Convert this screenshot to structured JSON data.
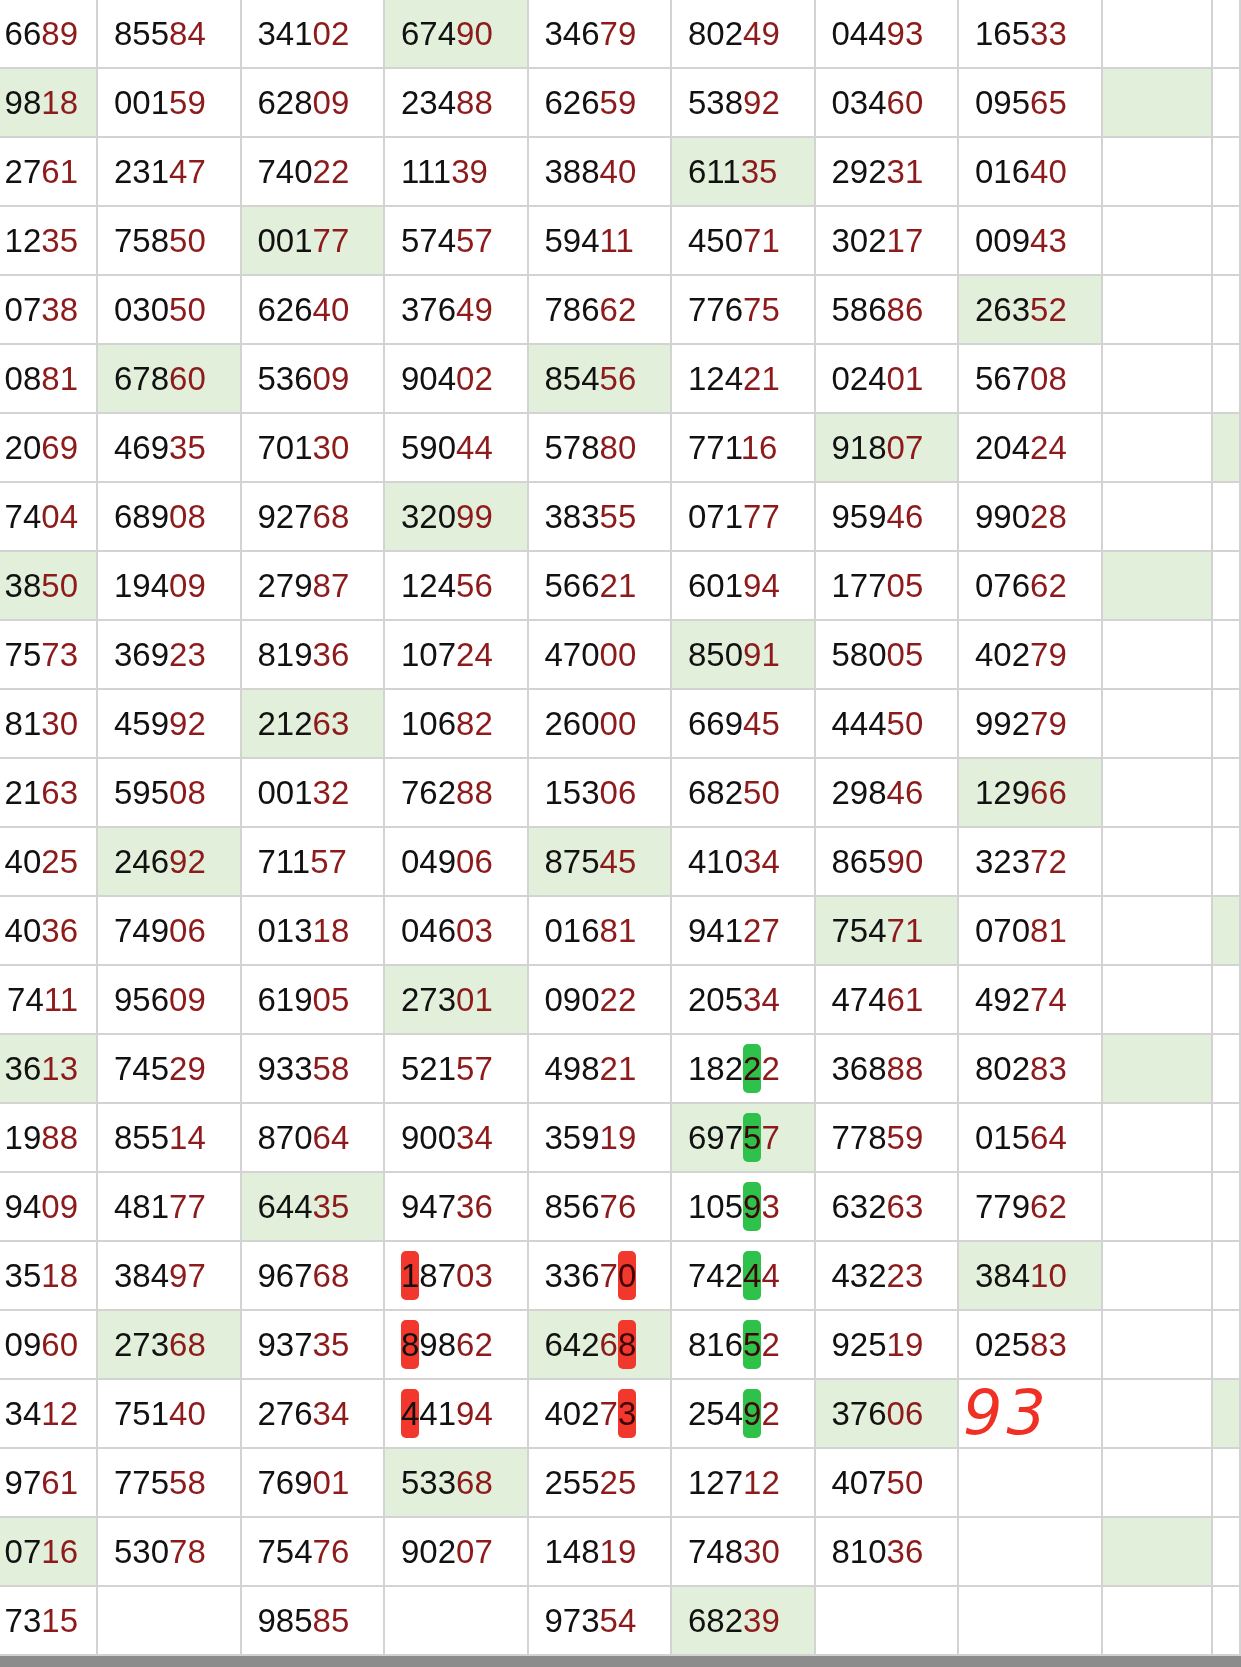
{
  "rows": [
    {
      "cells": [
        {
          "text": "6689",
          "highlighted": false
        },
        {
          "text": "85584",
          "highlighted": false
        },
        {
          "text": "34102",
          "highlighted": false
        },
        {
          "text": "67490",
          "highlighted": true
        },
        {
          "text": "34679",
          "highlighted": false
        },
        {
          "text": "80249",
          "highlighted": false
        },
        {
          "text": "04493",
          "highlighted": false
        },
        {
          "text": "16533",
          "highlighted": false
        },
        {
          "highlighted": false
        },
        {
          "highlighted": false
        }
      ]
    },
    {
      "cells": [
        {
          "text": "9818",
          "highlighted": true
        },
        {
          "text": "00159",
          "highlighted": false
        },
        {
          "text": "62809",
          "highlighted": false
        },
        {
          "text": "23488",
          "highlighted": false
        },
        {
          "text": "62659",
          "highlighted": false
        },
        {
          "text": "53892",
          "highlighted": false
        },
        {
          "text": "03460",
          "highlighted": false
        },
        {
          "text": "09565",
          "highlighted": false
        },
        {
          "highlighted": true
        },
        {
          "highlighted": false
        }
      ]
    },
    {
      "cells": [
        {
          "text": "2761",
          "highlighted": false
        },
        {
          "text": "23147",
          "highlighted": false
        },
        {
          "text": "74022",
          "highlighted": false
        },
        {
          "text": "11139",
          "highlighted": false
        },
        {
          "text": "38840",
          "highlighted": false
        },
        {
          "text": "61135",
          "highlighted": true
        },
        {
          "text": "29231",
          "highlighted": false
        },
        {
          "text": "01640",
          "highlighted": false
        },
        {
          "highlighted": false
        },
        {
          "highlighted": false
        }
      ]
    },
    {
      "cells": [
        {
          "text": "1235",
          "highlighted": false
        },
        {
          "text": "75850",
          "highlighted": false
        },
        {
          "text": "00177",
          "highlighted": true
        },
        {
          "text": "57457",
          "highlighted": false
        },
        {
          "text": "59411",
          "highlighted": false
        },
        {
          "text": "45071",
          "highlighted": false
        },
        {
          "text": "30217",
          "highlighted": false
        },
        {
          "text": "00943",
          "highlighted": false
        },
        {
          "highlighted": false
        },
        {
          "highlighted": false
        }
      ]
    },
    {
      "cells": [
        {
          "text": "0738",
          "highlighted": false
        },
        {
          "text": "03050",
          "highlighted": false
        },
        {
          "text": "62640",
          "highlighted": false
        },
        {
          "text": "37649",
          "highlighted": false
        },
        {
          "text": "78662",
          "highlighted": false
        },
        {
          "text": "77675",
          "highlighted": false
        },
        {
          "text": "58686",
          "highlighted": false
        },
        {
          "text": "26352",
          "highlighted": true
        },
        {
          "highlighted": false
        },
        {
          "highlighted": false
        }
      ]
    },
    {
      "cells": [
        {
          "text": "0881",
          "highlighted": false
        },
        {
          "text": "67860",
          "highlighted": true
        },
        {
          "text": "53609",
          "highlighted": false
        },
        {
          "text": "90402",
          "highlighted": false
        },
        {
          "text": "85456",
          "highlighted": true
        },
        {
          "text": "12421",
          "highlighted": false
        },
        {
          "text": "02401",
          "highlighted": false
        },
        {
          "text": "56708",
          "highlighted": false
        },
        {
          "highlighted": false
        },
        {
          "highlighted": false
        }
      ]
    },
    {
      "cells": [
        {
          "text": "2069",
          "highlighted": false
        },
        {
          "text": "46935",
          "highlighted": false
        },
        {
          "text": "70130",
          "highlighted": false
        },
        {
          "text": "59044",
          "highlighted": false
        },
        {
          "text": "57880",
          "highlighted": false
        },
        {
          "text": "77116",
          "highlighted": false
        },
        {
          "text": "91807",
          "highlighted": true
        },
        {
          "text": "20424",
          "highlighted": false
        },
        {
          "highlighted": false
        },
        {
          "highlighted": true
        }
      ]
    },
    {
      "cells": [
        {
          "text": "7404",
          "highlighted": false
        },
        {
          "text": "68908",
          "highlighted": false
        },
        {
          "text": "92768",
          "highlighted": false
        },
        {
          "text": "32099",
          "highlighted": true
        },
        {
          "text": "38355",
          "highlighted": false
        },
        {
          "text": "07177",
          "highlighted": false
        },
        {
          "text": "95946",
          "highlighted": false
        },
        {
          "text": "99028",
          "highlighted": false
        },
        {
          "highlighted": false
        },
        {
          "highlighted": false
        }
      ]
    },
    {
      "cells": [
        {
          "text": "3850",
          "highlighted": true
        },
        {
          "text": "19409",
          "highlighted": false
        },
        {
          "text": "27987",
          "highlighted": false
        },
        {
          "text": "12456",
          "highlighted": false
        },
        {
          "text": "56621",
          "highlighted": false
        },
        {
          "text": "60194",
          "highlighted": false
        },
        {
          "text": "17705",
          "highlighted": false
        },
        {
          "text": "07662",
          "highlighted": false
        },
        {
          "highlighted": true
        },
        {
          "highlighted": false
        }
      ]
    },
    {
      "cells": [
        {
          "text": "7573",
          "highlighted": false
        },
        {
          "text": "36923",
          "highlighted": false
        },
        {
          "text": "81936",
          "highlighted": false
        },
        {
          "text": "10724",
          "highlighted": false
        },
        {
          "text": "47000",
          "highlighted": false
        },
        {
          "text": "85091",
          "highlighted": true
        },
        {
          "text": "58005",
          "highlighted": false
        },
        {
          "text": "40279",
          "highlighted": false
        },
        {
          "highlighted": false
        },
        {
          "highlighted": false
        }
      ]
    },
    {
      "cells": [
        {
          "text": "8130",
          "highlighted": false
        },
        {
          "text": "45992",
          "highlighted": false
        },
        {
          "text": "21263",
          "highlighted": true
        },
        {
          "text": "10682",
          "highlighted": false
        },
        {
          "text": "26000",
          "highlighted": false
        },
        {
          "text": "66945",
          "highlighted": false
        },
        {
          "text": "44450",
          "highlighted": false
        },
        {
          "text": "99279",
          "highlighted": false
        },
        {
          "highlighted": false
        },
        {
          "highlighted": false
        }
      ]
    },
    {
      "cells": [
        {
          "text": "2163",
          "highlighted": false
        },
        {
          "text": "59508",
          "highlighted": false
        },
        {
          "text": "00132",
          "highlighted": false
        },
        {
          "text": "76288",
          "highlighted": false
        },
        {
          "text": "15306",
          "highlighted": false
        },
        {
          "text": "68250",
          "highlighted": false
        },
        {
          "text": "29846",
          "highlighted": false
        },
        {
          "text": "12966",
          "highlighted": true
        },
        {
          "highlighted": false
        },
        {
          "highlighted": false
        }
      ]
    },
    {
      "cells": [
        {
          "text": "4025",
          "highlighted": false
        },
        {
          "text": "24692",
          "highlighted": true
        },
        {
          "text": "71157",
          "highlighted": false
        },
        {
          "text": "04906",
          "highlighted": false
        },
        {
          "text": "87545",
          "highlighted": true
        },
        {
          "text": "41034",
          "highlighted": false
        },
        {
          "text": "86590",
          "highlighted": false
        },
        {
          "text": "32372",
          "highlighted": false
        },
        {
          "highlighted": false
        },
        {
          "highlighted": false
        }
      ]
    },
    {
      "cells": [
        {
          "text": "4036",
          "highlighted": false
        },
        {
          "text": "74906",
          "highlighted": false
        },
        {
          "text": "01318",
          "highlighted": false
        },
        {
          "text": "04603",
          "highlighted": false
        },
        {
          "text": "01681",
          "highlighted": false
        },
        {
          "text": "94127",
          "highlighted": false
        },
        {
          "text": "75471",
          "highlighted": true
        },
        {
          "text": "07081",
          "highlighted": false
        },
        {
          "highlighted": false
        },
        {
          "highlighted": true
        }
      ]
    },
    {
      "cells": [
        {
          "text": "7411",
          "highlighted": false
        },
        {
          "text": "95609",
          "highlighted": false
        },
        {
          "text": "61905",
          "highlighted": false
        },
        {
          "text": "27301",
          "highlighted": true
        },
        {
          "text": "09022",
          "highlighted": false
        },
        {
          "text": "20534",
          "highlighted": false
        },
        {
          "text": "47461",
          "highlighted": false
        },
        {
          "text": "49274",
          "highlighted": false
        },
        {
          "highlighted": false
        },
        {
          "highlighted": false
        }
      ]
    },
    {
      "cells": [
        {
          "text": "3613",
          "highlighted": true
        },
        {
          "text": "74529",
          "highlighted": false
        },
        {
          "text": "93358",
          "highlighted": false
        },
        {
          "text": "52157",
          "highlighted": false
        },
        {
          "text": "49821",
          "highlighted": false
        },
        {
          "text": "18222",
          "highlighted": false,
          "marker": {
            "color": "#2fc24a",
            "kind": "fourth"
          }
        },
        {
          "text": "36888",
          "highlighted": false
        },
        {
          "text": "80283",
          "highlighted": false
        },
        {
          "highlighted": true
        },
        {
          "highlighted": false
        }
      ]
    },
    {
      "cells": [
        {
          "text": "1988",
          "highlighted": false
        },
        {
          "text": "85514",
          "highlighted": false
        },
        {
          "text": "87064",
          "highlighted": false
        },
        {
          "text": "90034",
          "highlighted": false
        },
        {
          "text": "35919",
          "highlighted": false
        },
        {
          "text": "69757",
          "highlighted": true,
          "marker": {
            "color": "#2fc24a",
            "kind": "fourth"
          }
        },
        {
          "text": "77859",
          "highlighted": false
        },
        {
          "text": "01564",
          "highlighted": false
        },
        {
          "highlighted": false
        },
        {
          "highlighted": false
        }
      ]
    },
    {
      "cells": [
        {
          "text": "9409",
          "highlighted": false
        },
        {
          "text": "48177",
          "highlighted": false
        },
        {
          "text": "64435",
          "highlighted": true
        },
        {
          "text": "94736",
          "highlighted": false
        },
        {
          "text": "85676",
          "highlighted": false
        },
        {
          "text": "10593",
          "highlighted": false,
          "marker": {
            "color": "#2fc24a",
            "kind": "fourth"
          }
        },
        {
          "text": "63263",
          "highlighted": false
        },
        {
          "text": "77962",
          "highlighted": false
        },
        {
          "highlighted": false
        },
        {
          "highlighted": false
        }
      ]
    },
    {
      "cells": [
        {
          "text": "3518",
          "highlighted": false
        },
        {
          "text": "38497",
          "highlighted": false
        },
        {
          "text": "96768",
          "highlighted": false
        },
        {
          "text": "18703",
          "highlighted": false,
          "marker": {
            "color": "#f2382c",
            "kind": "first"
          }
        },
        {
          "text": "33670",
          "highlighted": false,
          "marker": {
            "color": "#f2382c",
            "kind": "last"
          }
        },
        {
          "text": "74244",
          "highlighted": false,
          "marker": {
            "color": "#2fc24a",
            "kind": "fourth"
          }
        },
        {
          "text": "43223",
          "highlighted": false
        },
        {
          "text": "38410",
          "highlighted": true
        },
        {
          "highlighted": false
        },
        {
          "highlighted": false
        }
      ]
    },
    {
      "cells": [
        {
          "text": "0960",
          "highlighted": false
        },
        {
          "text": "27368",
          "highlighted": true
        },
        {
          "text": "93735",
          "highlighted": false
        },
        {
          "text": "89862",
          "highlighted": false,
          "marker": {
            "color": "#f2382c",
            "kind": "first"
          }
        },
        {
          "text": "64268",
          "highlighted": true,
          "marker": {
            "color": "#f2382c",
            "kind": "last"
          }
        },
        {
          "text": "81652",
          "highlighted": false,
          "marker": {
            "color": "#2fc24a",
            "kind": "fourth"
          }
        },
        {
          "text": "92519",
          "highlighted": false
        },
        {
          "text": "02583",
          "highlighted": false
        },
        {
          "highlighted": false
        },
        {
          "highlighted": false
        }
      ]
    },
    {
      "cells": [
        {
          "text": "3412",
          "highlighted": false
        },
        {
          "text": "75140",
          "highlighted": false
        },
        {
          "text": "27634",
          "highlighted": false
        },
        {
          "text": "44194",
          "highlighted": false,
          "marker": {
            "color": "#f2382c",
            "kind": "first"
          }
        },
        {
          "text": "40273",
          "highlighted": false,
          "marker": {
            "color": "#f2382c",
            "kind": "last"
          }
        },
        {
          "text": "25492",
          "highlighted": false,
          "marker": {
            "color": "#2fc24a",
            "kind": "fourth"
          }
        },
        {
          "text": "37606",
          "highlighted": true
        },
        {
          "highlighted": false,
          "note": "93"
        },
        {
          "highlighted": false
        },
        {
          "highlighted": true
        }
      ]
    },
    {
      "cells": [
        {
          "text": "9761",
          "highlighted": false
        },
        {
          "text": "77558",
          "highlighted": false
        },
        {
          "text": "76901",
          "highlighted": false
        },
        {
          "text": "53368",
          "highlighted": true
        },
        {
          "text": "25525",
          "highlighted": false
        },
        {
          "text": "12712",
          "highlighted": false
        },
        {
          "text": "40750",
          "highlighted": false
        },
        {
          "highlighted": false
        },
        {
          "highlighted": false
        },
        {
          "highlighted": false
        }
      ]
    },
    {
      "cells": [
        {
          "text": "0716",
          "highlighted": true
        },
        {
          "text": "53078",
          "highlighted": false
        },
        {
          "text": "75476",
          "highlighted": false
        },
        {
          "text": "90207",
          "highlighted": false
        },
        {
          "text": "14819",
          "highlighted": false
        },
        {
          "text": "74830",
          "highlighted": false
        },
        {
          "text": "81036",
          "highlighted": false
        },
        {
          "highlighted": false
        },
        {
          "highlighted": true
        },
        {
          "highlighted": false
        }
      ]
    },
    {
      "cells": [
        {
          "text": "7315",
          "highlighted": false
        },
        {
          "highlighted": false
        },
        {
          "text": "98585",
          "highlighted": false
        },
        {
          "highlighted": false
        },
        {
          "text": "97354",
          "highlighted": false
        },
        {
          "text": "68239",
          "highlighted": true
        },
        {
          "highlighted": false
        },
        {
          "highlighted": false
        },
        {
          "highlighted": false
        },
        {
          "highlighted": false
        }
      ]
    }
  ]
}
